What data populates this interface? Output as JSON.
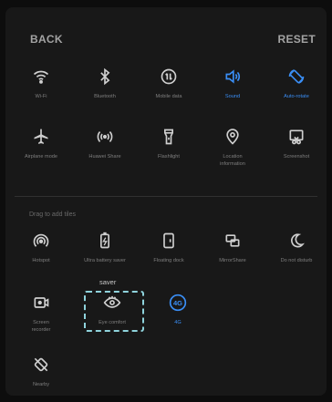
{
  "header": {
    "back_label": "BACK",
    "reset_label": "RESET"
  },
  "active_tiles": [
    {
      "label": "Wi-Fi",
      "icon": "wifi-icon",
      "on": false
    },
    {
      "label": "Bluetooth",
      "icon": "bluetooth-icon",
      "on": false
    },
    {
      "label": "Mobile data",
      "icon": "mobile-data-icon",
      "on": false
    },
    {
      "label": "Sound",
      "icon": "sound-icon",
      "on": true
    },
    {
      "label": "Auto-rotate",
      "icon": "auto-rotate-icon",
      "on": true
    },
    {
      "label": "Airplane mode",
      "icon": "airplane-icon",
      "on": false
    },
    {
      "label": "Huawei Share",
      "icon": "huawei-share-icon",
      "on": false
    },
    {
      "label": "Flashlight",
      "icon": "flashlight-icon",
      "on": false
    },
    {
      "label": "Location information",
      "icon": "location-icon",
      "on": false
    },
    {
      "label": "Screenshot",
      "icon": "screenshot-icon",
      "on": false
    }
  ],
  "section_label": "Drag to add tiles",
  "extra_tiles": [
    {
      "label": "Hotspot",
      "icon": "hotspot-icon",
      "on": false
    },
    {
      "label": "Ultra battery saver",
      "icon": "battery-icon",
      "on": false
    },
    {
      "label": "Floating dock",
      "icon": "floating-dock-icon",
      "on": false
    },
    {
      "label": "MirrorShare",
      "icon": "mirror-share-icon",
      "on": false
    },
    {
      "label": "Do not disturb",
      "icon": "moon-icon",
      "on": false
    },
    {
      "label": "Screen recorder",
      "icon": "screen-recorder-icon",
      "on": false
    },
    {
      "label": "Eye comfort",
      "icon": "eye-icon",
      "on": false
    },
    {
      "label": "4G",
      "icon": "4g-icon",
      "on": true
    },
    {
      "label": "Nearby",
      "icon": "nearby-icon",
      "on": false
    }
  ],
  "dragging_label": "saver",
  "colors": {
    "active": "#3a8ef5",
    "background": "#181818",
    "drag_outline": "#8fd3dc"
  }
}
